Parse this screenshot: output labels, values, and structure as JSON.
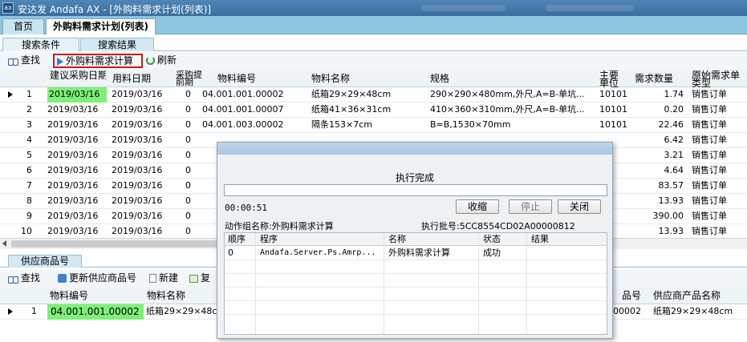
{
  "window": {
    "logo_text": "ax",
    "title": "安达发 Andafa AX - [外购料需求计划(列表)]"
  },
  "main_tabs": [
    {
      "label": "首页"
    },
    {
      "label": "外购料需求计划(列表)"
    }
  ],
  "sub_tabs": [
    {
      "label": "搜索条件"
    },
    {
      "label": "搜索结果"
    }
  ],
  "toolbar": {
    "find_label": "查找",
    "calc_label": "外购料需求计算",
    "refresh_label": "刷新"
  },
  "grid": {
    "columns": [
      {
        "label": "建议采购日期"
      },
      {
        "label": "用料日期"
      },
      {
        "label": "采购提前期"
      },
      {
        "label": "物料编号"
      },
      {
        "label": "物料名称"
      },
      {
        "label": "规格"
      },
      {
        "label": "主要单位"
      },
      {
        "label": "需求数量"
      },
      {
        "label": "原始需求单类型"
      }
    ],
    "rows": [
      {
        "no": "1",
        "suggest_date": "2019/03/16",
        "use_date": "2019/03/16",
        "lead": "0",
        "code": "04.001.001.00002",
        "name": "纸箱29×29×48cm",
        "spec": "290×290×480mm,外尺,A=B-单坑...",
        "unit": "10101",
        "qty": "1.74",
        "type": "销售订单"
      },
      {
        "no": "2",
        "suggest_date": "2019/03/16",
        "use_date": "2019/03/16",
        "lead": "0",
        "code": "04.001.001.00007",
        "name": "纸箱41×36×31cm",
        "spec": "410×360×310mm,外尺,A=B-单坑...",
        "unit": "10101",
        "qty": "0.20",
        "type": "销售订单"
      },
      {
        "no": "3",
        "suggest_date": "2019/03/16",
        "use_date": "2019/03/16",
        "lead": "0",
        "code": "04.001.003.00002",
        "name": "隔条153×7cm",
        "spec": "B=B,1530×70mm",
        "unit": "10101",
        "qty": "22.46",
        "type": "销售订单"
      },
      {
        "no": "4",
        "suggest_date": "2019/03/16",
        "use_date": "2019/03/16",
        "lead": "0",
        "code": "",
        "name": "",
        "spec": "",
        "unit": "",
        "qty": "6.42",
        "type": "销售订单"
      },
      {
        "no": "5",
        "suggest_date": "2019/03/16",
        "use_date": "2019/03/16",
        "lead": "0",
        "code": "",
        "name": "",
        "spec": "",
        "unit": "",
        "qty": "3.21",
        "type": "销售订单"
      },
      {
        "no": "6",
        "suggest_date": "2019/03/16",
        "use_date": "2019/03/16",
        "lead": "0",
        "code": "",
        "name": "",
        "spec": "",
        "unit": "",
        "qty": "4.64",
        "type": "销售订单"
      },
      {
        "no": "7",
        "suggest_date": "2019/03/16",
        "use_date": "2019/03/16",
        "lead": "0",
        "code": "",
        "name": "",
        "spec": "",
        "unit": "",
        "qty": "83.57",
        "type": "销售订单"
      },
      {
        "no": "8",
        "suggest_date": "2019/03/16",
        "use_date": "2019/03/16",
        "lead": "0",
        "code": "",
        "name": "",
        "spec": "",
        "unit": "",
        "qty": "13.93",
        "type": "销售订单"
      },
      {
        "no": "9",
        "suggest_date": "2019/03/16",
        "use_date": "2019/03/16",
        "lead": "0",
        "code": "",
        "name": "",
        "spec": "",
        "unit": "",
        "qty": "390.00",
        "type": "销售订单"
      },
      {
        "no": "10",
        "suggest_date": "2019/03/16",
        "use_date": "2019/03/16",
        "lead": "0",
        "code": "",
        "name": "",
        "spec": "",
        "unit": "",
        "qty": "13.93",
        "type": "销售订单"
      }
    ]
  },
  "lower": {
    "tab_label": "供应商品号",
    "toolbar": {
      "find_label": "查找",
      "update_label": "更新供应商品号",
      "new_label": "新建",
      "copy_label": "复"
    },
    "columns": [
      {
        "label": "物料编号"
      },
      {
        "label": "物料名称"
      },
      {
        "label": "品号"
      },
      {
        "label": "供应商产品名称"
      }
    ],
    "rows": [
      {
        "no": "1",
        "code": "04.001.001.00002",
        "name": "纸箱29×29×48c",
        "supplier_code": "00002",
        "supplier_name": "纸箱29×29×48cm"
      }
    ]
  },
  "dialog": {
    "status": "执行完成",
    "elapsed": "00:00:51",
    "collapse_label": "收缩",
    "stop_label": "停止",
    "close_label": "关闭",
    "group_label": "动作组名称:外购料需求计算",
    "batch_label": "执行批号:5CC8554CD02A00000812",
    "columns": [
      {
        "label": "顺序"
      },
      {
        "label": "程序"
      },
      {
        "label": "名称"
      },
      {
        "label": "状态"
      },
      {
        "label": "结果"
      }
    ],
    "rows": [
      {
        "order": "0",
        "program": "Andafa.Server.Ps.Amrp...",
        "name": "外购料需求计算",
        "status": "成功",
        "result": ""
      }
    ]
  }
}
